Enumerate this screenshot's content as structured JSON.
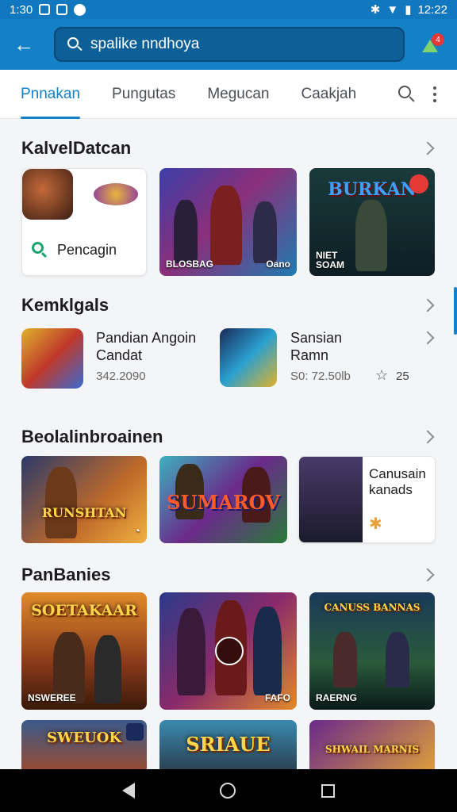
{
  "status_bar": {
    "time_left": "1:30",
    "time_right": "12:22"
  },
  "search": {
    "value": "spalike nndhoya"
  },
  "notifications": {
    "badge": "4"
  },
  "tabs": [
    {
      "label": "Pnnakan"
    },
    {
      "label": "Pungutas"
    },
    {
      "label": "Megucan"
    },
    {
      "label": "Caakjah"
    }
  ],
  "sections": {
    "s1": {
      "title": "KalvelDatcan",
      "card1_label": "Pencagin",
      "card2_caption_left": "BLOSBAG",
      "card2_caption_right": "Oano",
      "card3_title": "BURKAN",
      "card3_caption": "NIET SOAM"
    },
    "s2": {
      "title": "Kemklgals",
      "apps": [
        {
          "name_line1": "Pandian Angoin",
          "name_line2": "Candat",
          "meta": "342.2090"
        },
        {
          "name_line1": "Sansian",
          "name_line2": "Ramn",
          "meta": "S0: 72.50lb",
          "rating": "25"
        }
      ]
    },
    "s3": {
      "title": "Beolalinbroainen",
      "card1_art": "RUNSHTAN",
      "card2_art": "SUMAROV",
      "card3_text_line1": "Canusain",
      "card3_text_line2": "kanads"
    },
    "s4": {
      "title": "PanBanies",
      "card1_art": "SOETAKAAR",
      "card1_caption": "NSWEREE",
      "card2_caption": "FAFO",
      "card3_art": "CANUSS BANNAS",
      "card3_caption": "RAERNG",
      "card4_art": "SWEUOK",
      "card5_art": "SRIAUE",
      "card6_art": "SHWAIL MARNIS"
    }
  },
  "colors": {
    "accent": "#1380c8",
    "app_bar": "#1380c8",
    "status_bar": "#1178c0"
  }
}
